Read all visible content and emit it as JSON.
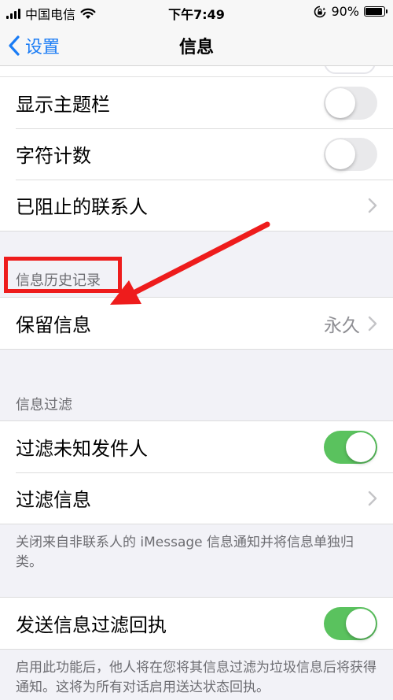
{
  "status_bar": {
    "carrier": "中国电信",
    "time": "下午7:49",
    "battery_percent": "90%",
    "battery_level": 0.9
  },
  "nav": {
    "back_label": "设置",
    "title": "信息"
  },
  "group1": {
    "show_subject": {
      "label": "显示主题栏",
      "on": false
    },
    "char_count": {
      "label": "字符计数",
      "on": false
    },
    "blocked": {
      "label": "已阻止的联系人"
    }
  },
  "history": {
    "header": "信息历史记录",
    "keep_messages": {
      "label": "保留信息",
      "value": "永久"
    }
  },
  "filtering": {
    "header": "信息过滤",
    "filter_unknown": {
      "label": "过滤未知发件人",
      "on": true
    },
    "filter_messages": {
      "label": "过滤信息"
    },
    "footer": "关闭来自非联系人的 iMessage 信息通知并将信息单独归类。"
  },
  "receipts": {
    "send_filter_receipts": {
      "label": "发送信息过滤回执",
      "on": true
    },
    "footer": "启用此功能后，他人将在您将其信息过滤为垃圾信息后将获得通知。这将为所有对话启用送达状态回执。"
  },
  "colors": {
    "accent": "#1a7cf5",
    "toggle_on": "#5ac25e",
    "annotation_red": "#ee1c1c"
  },
  "icons": {
    "back": "chevron-left-icon",
    "disclosure": "chevron-right-icon",
    "wifi": "wifi-icon",
    "lock_rotation": "orientation-lock-icon",
    "battery": "battery-icon"
  }
}
